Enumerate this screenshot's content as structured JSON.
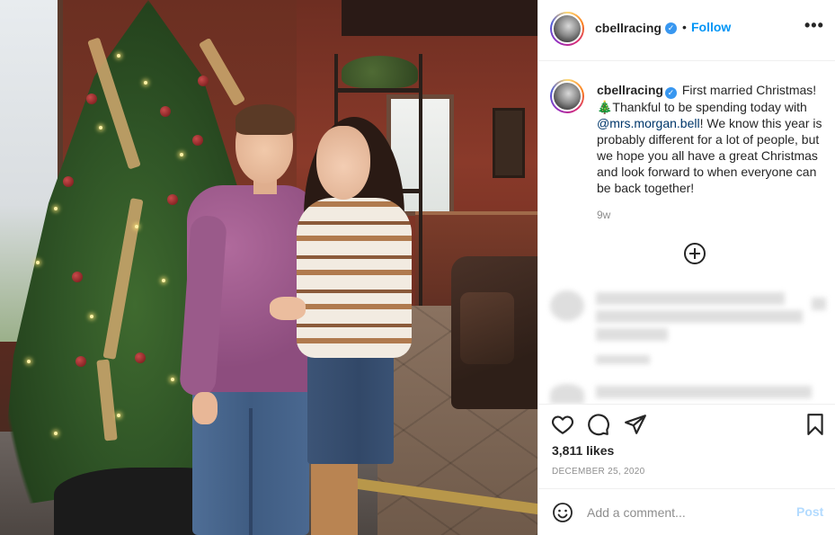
{
  "post": {
    "username": "cbellracing",
    "follow_label": "Follow",
    "separator": "•",
    "more_label": "•••",
    "verified_mark": "✓"
  },
  "caption": {
    "username": "cbellracing",
    "text_part1": "First married Christmas! 🎄Thankful to be spending today with ",
    "mention": "@mrs.morgan.bell",
    "text_part2": "! We know this year is probably different for a lot of people, but we hope you all have a great Christmas and look forward to when everyone can be back together!",
    "time_ago": "9w"
  },
  "stats": {
    "likes": "3,811 likes",
    "date": "DECEMBER 25, 2020"
  },
  "comment": {
    "placeholder": "Add a comment...",
    "post_label": "Post"
  },
  "icons": {
    "like": "heart-icon",
    "comment": "comment-icon",
    "share": "paper-plane-icon",
    "save": "bookmark-icon",
    "emoji": "smiley-icon",
    "add": "plus-circle-icon"
  },
  "colors": {
    "link": "#0095f6",
    "verified": "#3897f0",
    "mention": "#00376b",
    "post_disabled": "#b3dbff"
  }
}
